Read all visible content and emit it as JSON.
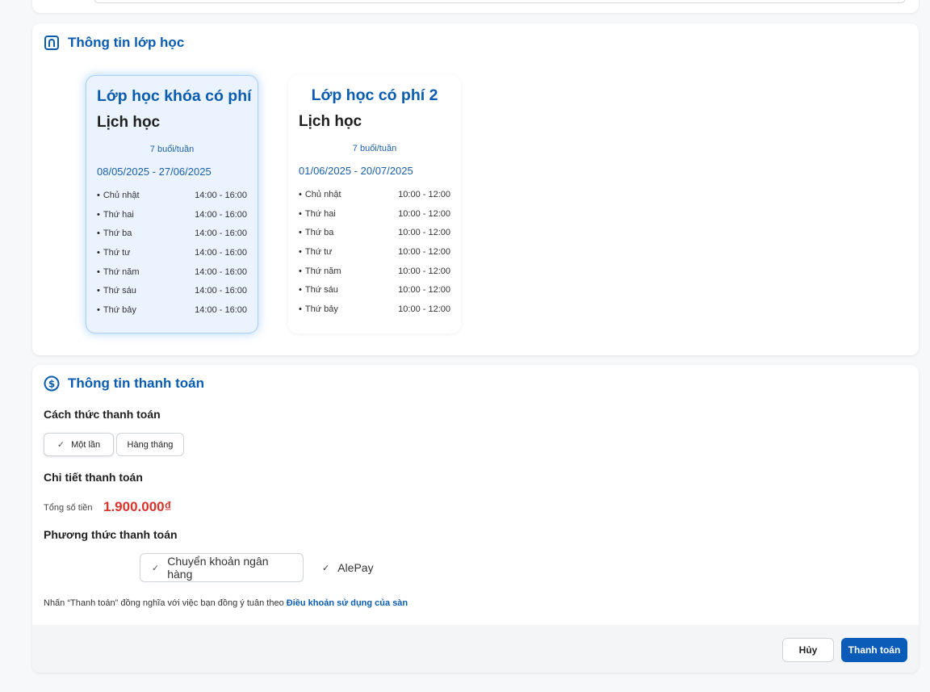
{
  "class_info": {
    "title": "Thông tin lớp học",
    "classes": [
      {
        "name": "Lớp học khóa có phí",
        "schedule_title": "Lịch học",
        "frequency": "7 buổi/tuần",
        "date_range": "08/05/2025 - 27/06/2025",
        "selected": true,
        "sessions": [
          {
            "day": "Chủ nhật",
            "time": "14:00 - 16:00"
          },
          {
            "day": "Thứ hai",
            "time": "14:00 - 16:00"
          },
          {
            "day": "Thứ ba",
            "time": "14:00 - 16:00"
          },
          {
            "day": "Thứ tư",
            "time": "14:00 - 16:00"
          },
          {
            "day": "Thứ năm",
            "time": "14:00 - 16:00"
          },
          {
            "day": "Thứ sáu",
            "time": "14:00 - 16:00"
          },
          {
            "day": "Thứ bảy",
            "time": "14:00 - 16:00"
          }
        ]
      },
      {
        "name": "Lớp học có phí 2",
        "schedule_title": "Lịch học",
        "frequency": "7 buổi/tuần",
        "date_range": "01/06/2025 - 20/07/2025",
        "selected": false,
        "sessions": [
          {
            "day": "Chủ nhật",
            "time": "10:00 - 12:00"
          },
          {
            "day": "Thứ hai",
            "time": "10:00 - 12:00"
          },
          {
            "day": "Thứ ba",
            "time": "10:00 - 12:00"
          },
          {
            "day": "Thứ tư",
            "time": "10:00 - 12:00"
          },
          {
            "day": "Thứ năm",
            "time": "10:00 - 12:00"
          },
          {
            "day": "Thứ sáu",
            "time": "10:00 - 12:00"
          },
          {
            "day": "Thứ bảy",
            "time": "10:00 - 12:00"
          }
        ]
      }
    ]
  },
  "payment": {
    "title": "Thông tin thanh toán",
    "method_label": "Cách thức thanh toán",
    "options": {
      "once": "Một lần",
      "monthly": "Hàng tháng"
    },
    "detail_label": "Chi tiết thanh toán",
    "total_label": "Tổng số tiền",
    "total_value": "1.900.000₫",
    "channel_label": "Phương thức thanh toán",
    "channels": {
      "bank": "Chuyển khoản ngân hàng",
      "alepay": "AlePay"
    },
    "terms_text": "Nhấn “Thanh toán” đồng nghĩa với việc bạn đồng ý tuân theo",
    "terms_link": "Điều khoản sử dụng của sàn",
    "cancel_label": "Hủy",
    "pay_label": "Thanh toán"
  },
  "colors": {
    "accent": "#0a5cb0",
    "price": "#d9342b",
    "primary_button": "#0b5cb8"
  },
  "icons": {
    "class_section": "classroom-icon",
    "payment_section": "dollar-circle-icon",
    "check": "check-icon"
  }
}
